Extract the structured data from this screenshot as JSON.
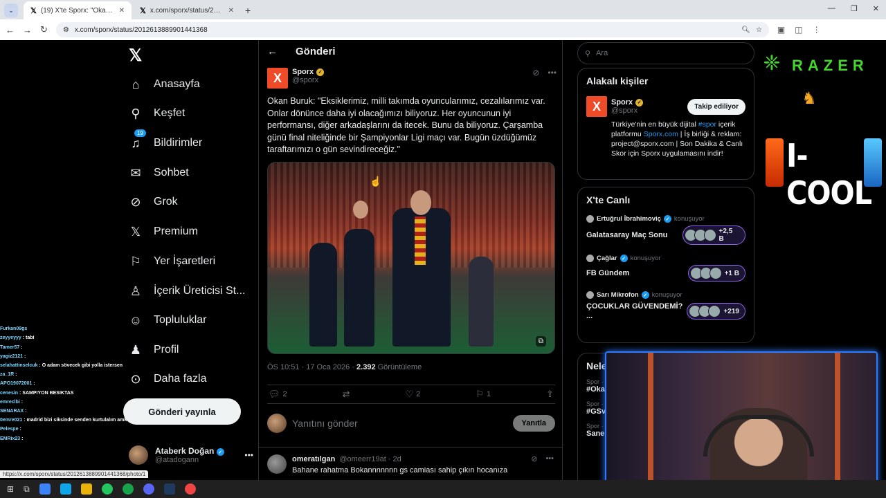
{
  "browser": {
    "tabs": [
      {
        "title": "(19) X'te Sporx: \"Okan Buruk: \"E",
        "active": true
      },
      {
        "title": "x.com/sporx/status/20126134",
        "active": false
      }
    ],
    "url": "x.com/sporx/status/2012613889901441368"
  },
  "nav": {
    "items": [
      {
        "label": "Anasayfa",
        "icon": "home-icon"
      },
      {
        "label": "Keşfet",
        "icon": "search-icon"
      },
      {
        "label": "Bildirimler",
        "icon": "bell-icon",
        "badge": "19"
      },
      {
        "label": "Sohbet",
        "icon": "mail-icon"
      },
      {
        "label": "Grok",
        "icon": "grok-icon"
      },
      {
        "label": "Premium",
        "icon": "x-icon"
      },
      {
        "label": "Yer İşaretleri",
        "icon": "bookmark-icon"
      },
      {
        "label": "İçerik Üreticisi St...",
        "icon": "studio-icon"
      },
      {
        "label": "Topluluklar",
        "icon": "community-icon"
      },
      {
        "label": "Profil",
        "icon": "profile-icon"
      },
      {
        "label": "Daha fazla",
        "icon": "more-icon"
      }
    ],
    "post_button": "Gönderi yayınla",
    "account": {
      "name": "Ataberk Doğan",
      "handle": "@atadogann"
    }
  },
  "main": {
    "header": "Gönderi",
    "tweet": {
      "name": "Sporx",
      "handle": "@sporx",
      "text": "Okan Buruk: \"Eksiklerimiz, milli takımda oyuncularımız, cezalılarımız var. Onlar dönünce daha iyi olacağımızı biliyoruz. Her oyuncunun iyi performansı, diğer arkadaşlarını da itecek. Bunu da biliyoruz. Çarşamba günü final niteliğinde bir Şampiyonlar Ligi maçı var. Bugün üzdüğümüz taraftarımızı o gün sevindireceğiz.\"",
      "time": "ÖS 10:51 · 17 Oca 2026 · ",
      "views": "2.392",
      "views_label": " Görüntüleme",
      "replies": "2",
      "likes": "2",
      "bookmarks": "1"
    },
    "reply_placeholder": "Yanıtını gönder",
    "reply_button": "Yanıtla",
    "comment": {
      "name": "omeratılgan",
      "handle": "@omeerr19at · 2d",
      "text": "Bahane rahatma Bokannnnnnn gs camiası sahip çıkın hocanıza"
    }
  },
  "right": {
    "search_placeholder": "Ara",
    "related_title": "Alakalı kişiler",
    "related": {
      "name": "Sporx",
      "handle": "@sporx",
      "follow": "Takip ediliyor",
      "bio_1": "Türkiye'nin en büyük dijital ",
      "bio_tag": "#spor",
      "bio_2": " içerik platformu ",
      "bio_link": "Sporx.com",
      "bio_3": " | İş birliği & reklam: project@sporx.com | Son Dakika & Canlı Skor için Sporx uygulamasını indir!"
    },
    "live_title": "X'te Canlı",
    "spaces": [
      {
        "host": "Ertuğrul İbrahimoviç",
        "status": "konuşuyor",
        "title": "Galatasaray Maç Sonu",
        "count": "+2,5 B"
      },
      {
        "host": "Çağlar",
        "status": "konuşuyor",
        "title": "FB Gündem",
        "count": "+1 B"
      },
      {
        "host": "Sarı Mikrofon",
        "status": "konuşuyor",
        "title": "ÇOCUKLAR GÜVENDEMİ? ...",
        "count": "+219"
      }
    ],
    "trends_title": "Nele",
    "trends": [
      {
        "meta": "Spor ·",
        "tag": "#Oka"
      },
      {
        "meta": "Spor ·",
        "tag": "#GSv"
      },
      {
        "meta": "Spor ·",
        "tag": "Sane"
      }
    ]
  },
  "sponsor": {
    "brand": "RAZER",
    "drink": "I-COOL"
  },
  "chat": [
    {
      "user": "Furkan09gs",
      "msg": ""
    },
    {
      "user": "zeyyeyyy",
      "msg": " : tabi"
    },
    {
      "user": "Tamer57",
      "msg": " :"
    },
    {
      "user": "yagiz2121",
      "msg": " :"
    },
    {
      "user": "selahattinselcuk",
      "msg": " : O adam sövecek gibi yolla istersen"
    },
    {
      "user": "za_1R",
      "msg": " :"
    },
    {
      "user": "APO19072001",
      "msg": " :"
    },
    {
      "user": "cenesin",
      "msg": " : SAMPIYON BESIKTAS"
    },
    {
      "user": "emreclbi",
      "msg": " :"
    },
    {
      "user": "SENARAX",
      "msg": " :"
    },
    {
      "user": "0emre021",
      "msg": " : madrid bizi siksinde senden kurtulalım amk"
    },
    {
      "user": "Pelespe",
      "msg": " :"
    },
    {
      "user": "EMRix23",
      "msg": " :"
    }
  ],
  "status_url": "https://x.com/sporx/status/2012613889901441368/photo/1",
  "colors": {
    "accent": "#1d9bf0",
    "brand_orange": "#ef4b28",
    "razer_green": "#44d62c",
    "space_purple": "#8e63e8"
  }
}
